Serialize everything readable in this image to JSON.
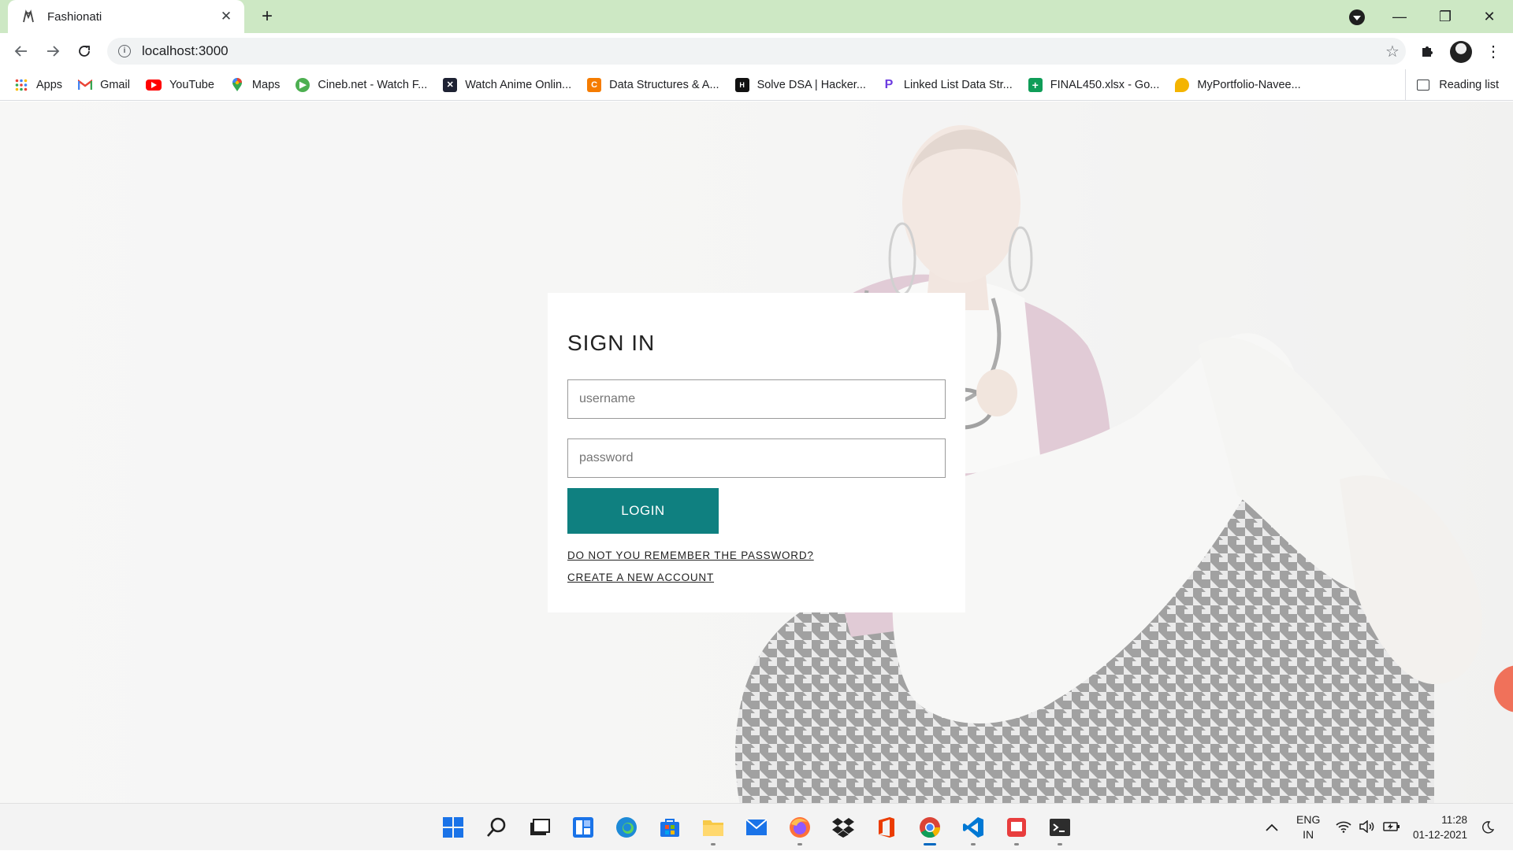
{
  "browser": {
    "tab_title": "Fashionati",
    "tab_close": "✕",
    "new_tab": "+",
    "url": "localhost:3000",
    "window_controls": {
      "minimize": "—",
      "restore": "❐",
      "close": "✕"
    }
  },
  "bookmarks": [
    {
      "label": "Apps",
      "icon": "apps-grid-icon",
      "color": "#4285f4"
    },
    {
      "label": "Gmail",
      "icon": "gmail-icon",
      "color": "#ea4335"
    },
    {
      "label": "YouTube",
      "icon": "youtube-icon",
      "color": "#ff0000"
    },
    {
      "label": "Maps",
      "icon": "maps-pin-icon",
      "color": "#34a853"
    },
    {
      "label": "Cineb.net - Watch F...",
      "icon": "cineb-icon",
      "color": "#4caf50"
    },
    {
      "label": "Watch Anime Onlin...",
      "icon": "anime-icon",
      "color": "#1e2233"
    },
    {
      "label": "Data Structures & A...",
      "icon": "codingninjas-icon",
      "color": "#f57c00"
    },
    {
      "label": "Solve DSA | Hacker...",
      "icon": "hackerrank-icon",
      "color": "#111111"
    },
    {
      "label": "Linked List Data Str...",
      "icon": "programiz-icon",
      "color": "#6c3be0"
    },
    {
      "label": "FINAL450.xlsx - Go...",
      "icon": "sheets-icon",
      "color": "#0f9d58"
    },
    {
      "label": "MyPortfolio-Navee...",
      "icon": "portfolio-icon",
      "color": "#f4b400"
    }
  ],
  "reading_list": "Reading list",
  "signin": {
    "heading": "SIGN IN",
    "username_placeholder": "username",
    "password_placeholder": "password",
    "login_label": "LOGIN",
    "forgot_link": "DO NOT YOU REMEMBER THE PASSWORD?",
    "create_link": "CREATE A NEW ACCOUNT",
    "accent_color": "#0f8080"
  },
  "taskbar": {
    "language": "ENG",
    "region": "IN",
    "time": "11:28",
    "date": "01-12-2021"
  }
}
